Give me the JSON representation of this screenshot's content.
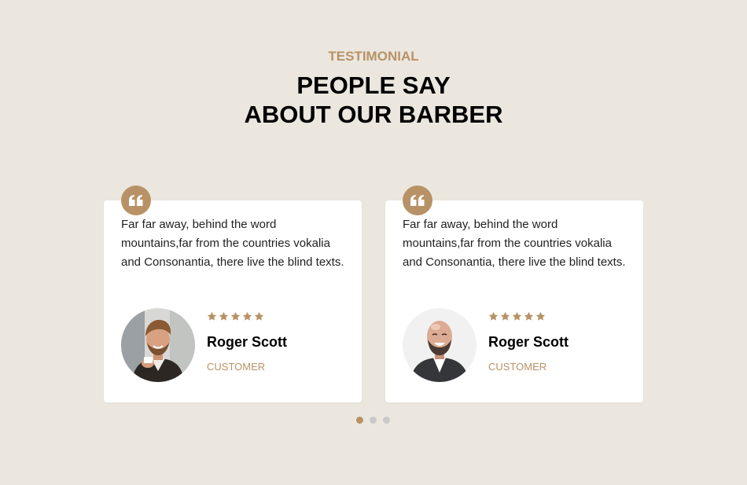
{
  "section": {
    "eyebrow": "TESTIMONIAL",
    "title_line1": "PEOPLE SAY",
    "title_line2": "ABOUT OUR BARBER"
  },
  "testimonials": [
    {
      "text": "Far far away, behind the word mountains,far from the countries vokalia and Consonantia, there live the blind texts.",
      "rating": 5,
      "name": "Roger Scott",
      "role": "CUSTOMER",
      "avatar": "man-holding-coffee-cup-photo"
    },
    {
      "text": "Far far away, behind the word mountains,far from the countries vokalia and Consonantia, there live the blind texts.",
      "rating": 5,
      "name": "Roger Scott",
      "role": "CUSTOMER",
      "avatar": "bald-bearded-man-laughing-photo"
    }
  ],
  "carousel": {
    "pages": 3,
    "active_page": 1
  },
  "colors": {
    "background": "#ebe7df",
    "accent": "#b89266",
    "card": "#ffffff",
    "dot_inactive": "#c9c9c9"
  },
  "icons": {
    "quote": "quote-icon",
    "star": "star-icon"
  }
}
